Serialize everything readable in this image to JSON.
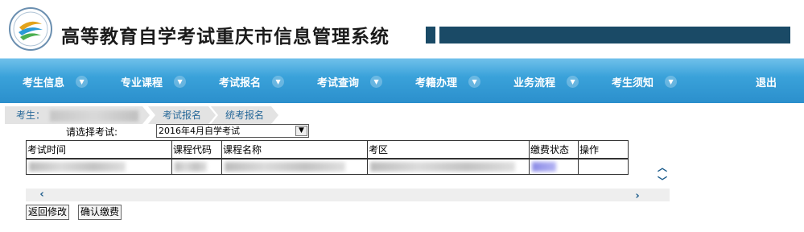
{
  "header": {
    "title": "高等教育自学考试重庆市信息管理系统",
    "logo_icon": "exam-logo-icon",
    "accent": "#1a4a66"
  },
  "nav": {
    "items": [
      {
        "label": "考生信息"
      },
      {
        "label": "专业课程"
      },
      {
        "label": "考试报名"
      },
      {
        "label": "考试查询"
      },
      {
        "label": "考籍办理"
      },
      {
        "label": "业务流程"
      },
      {
        "label": "考生须知"
      }
    ],
    "logout": "退出",
    "background": "#3aa2da"
  },
  "breadcrumb": {
    "student_prefix": "考生：",
    "step1": "考试报名",
    "step2": "统考报名"
  },
  "exam_select": {
    "label": "请选择考试:",
    "selected": "2016年4月自学考试"
  },
  "table": {
    "headers": [
      "考试时间",
      "课程代码",
      "课程名称",
      "考区",
      "缴费状态",
      "操作"
    ]
  },
  "buttons": {
    "back": "返回修改",
    "confirm": "确认缴费"
  }
}
